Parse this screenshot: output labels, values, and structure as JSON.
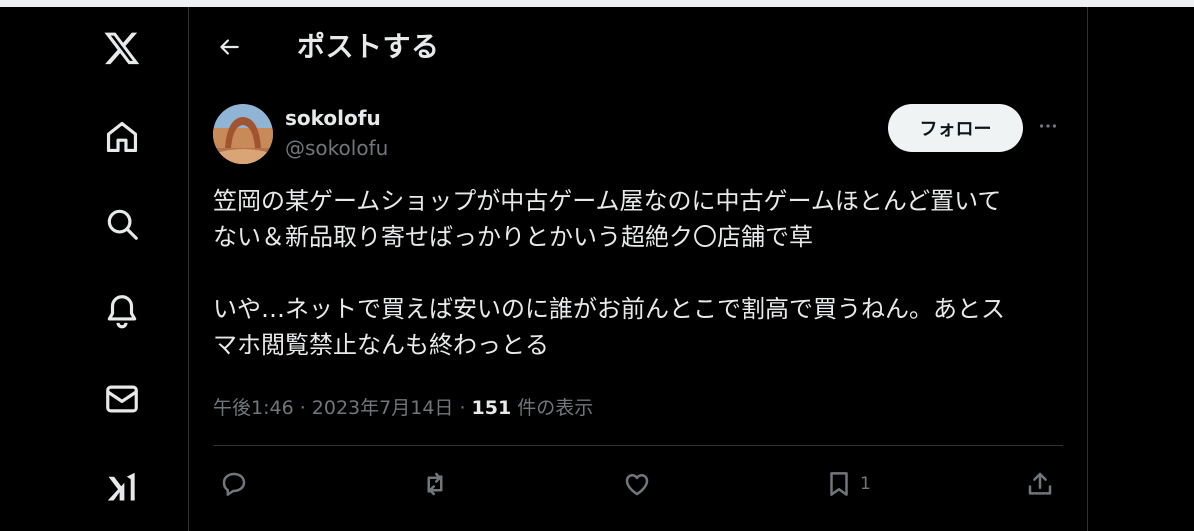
{
  "header": {
    "title": "ポストする"
  },
  "sidebar": {
    "items": [
      {
        "icon": "x-logo-icon"
      },
      {
        "icon": "home-icon"
      },
      {
        "icon": "search-icon"
      },
      {
        "icon": "bell-icon"
      },
      {
        "icon": "mail-icon"
      },
      {
        "icon": "grok-icon"
      }
    ]
  },
  "post": {
    "username": "sokolofu",
    "handle": "@sokolofu",
    "follow_label": "フォロー",
    "more_icon": "more-icon",
    "lines": [
      "笠岡の某ゲームショップが中古ゲーム屋なのに中古ゲームほとんど置いて",
      "ない＆新品取り寄せばっかりとかいう超絶ク〇店舗で草",
      "いや…ネットで買えば安いのに誰がお前んとこで割高で買うねん。あとス",
      "マホ閲覧禁止なんも終わっとる"
    ],
    "time": "午後1:46",
    "sep": " · ",
    "date": "2023年7月14日",
    "views_count": "151",
    "views_label": " 件の表示"
  },
  "actions": {
    "reply_icon": "reply-icon",
    "repost_icon": "repost-icon",
    "like_icon": "like-icon",
    "bookmark_icon": "bookmark-icon",
    "bookmark_count": "1",
    "share_icon": "share-icon"
  },
  "colors": {
    "background": "#000000",
    "text": "#e7e9ea",
    "muted": "#71767b",
    "border": "#2f3336",
    "follow_bg": "#eff3f4"
  }
}
